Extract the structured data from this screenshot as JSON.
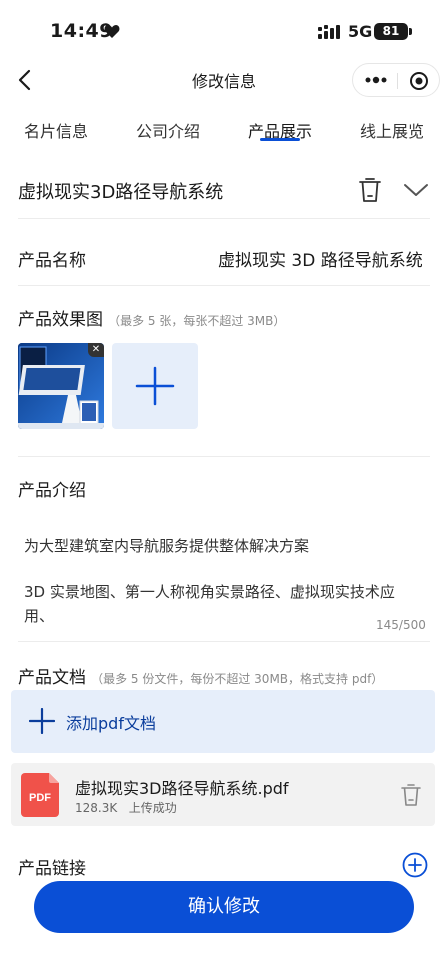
{
  "status_bar": {
    "time": "14:49",
    "network": "5G",
    "battery": "81"
  },
  "nav": {
    "title": "修改信息"
  },
  "tabs": [
    {
      "label": "名片信息"
    },
    {
      "label": "公司介绍"
    },
    {
      "label": "产品展示",
      "active": true
    },
    {
      "label": "线上展览"
    }
  ],
  "product": {
    "header_title": "虚拟现实3D路径导航系统",
    "name_label": "产品名称",
    "name_value": "虚拟现实 3D 路径导航系统",
    "images_label": "产品效果图",
    "images_hint": "（最多 5 张，每张不超过 3MB）",
    "intro_label": "产品介绍",
    "intro_line1": "为大型建筑室内导航服务提供整体解决方案",
    "intro_line2": "3D 实景地图、第一人称视角实景路径、虚拟现实技术应",
    "intro_line3": "用、",
    "intro_counter": "145/500",
    "docs_label": "产品文档",
    "docs_hint": "（最多 5 份文件，每份不超过 30MB，格式支持 pdf）",
    "add_pdf_label": "添加pdf文档",
    "file": {
      "badge": "PDF",
      "name": "虚拟现实3D路径导航系统.pdf",
      "size": "128.3K",
      "status": "上传成功"
    },
    "links_label": "产品链接"
  },
  "confirm_label": "确认修改",
  "colors": {
    "accent": "#0a4fd6",
    "light_accent": "#e6eefa",
    "pdf_red": "#f0524a"
  }
}
